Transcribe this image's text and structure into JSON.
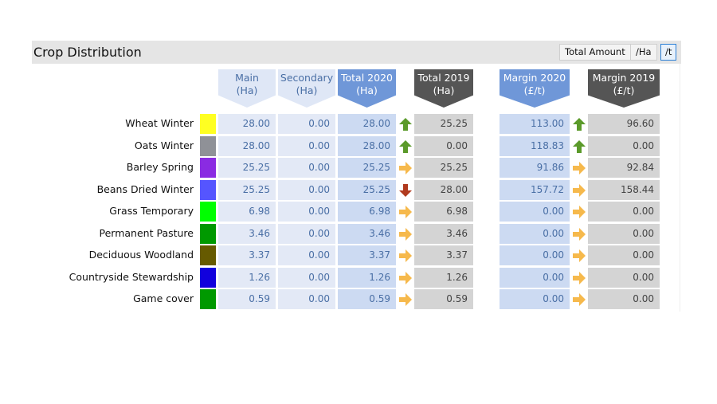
{
  "panel": {
    "title": "Crop Distribution",
    "buttons": [
      {
        "label": "Total Amount",
        "active": false
      },
      {
        "label": "/Ha",
        "active": false
      },
      {
        "label": "/t",
        "active": true
      }
    ]
  },
  "columns": {
    "main": {
      "line1": "Main",
      "line2": "(Ha)"
    },
    "secondary": {
      "line1": "Secondary",
      "line2": "(Ha)"
    },
    "total2020": {
      "line1": "Total 2020",
      "line2": "(Ha)"
    },
    "total2019": {
      "line1": "Total 2019",
      "line2": "(Ha)"
    },
    "margin2020": {
      "line1": "Margin 2020",
      "line2": "(£/t)"
    },
    "margin2019": {
      "line1": "Margin 2019",
      "line2": "(£/t)"
    }
  },
  "trend_icons": {
    "up": {
      "name": "arrow-up-icon",
      "color": "#5b9a2a"
    },
    "down": {
      "name": "arrow-down-icon",
      "color": "#b03a1e"
    },
    "flat": {
      "name": "arrow-right-icon",
      "color": "#f6b94c"
    }
  },
  "rows": [
    {
      "crop": "Wheat Winter",
      "color": "#ffff22",
      "main": "28.00",
      "secondary": "0.00",
      "total2020": "28.00",
      "total_trend": "up",
      "total2019": "25.25",
      "margin2020": "113.00",
      "margin_trend": "up",
      "margin2019": "96.60"
    },
    {
      "crop": "Oats Winter",
      "color": "#8f9197",
      "main": "28.00",
      "secondary": "0.00",
      "total2020": "28.00",
      "total_trend": "up",
      "total2019": "0.00",
      "margin2020": "118.83",
      "margin_trend": "up",
      "margin2019": "0.00"
    },
    {
      "crop": "Barley Spring",
      "color": "#8a2be2",
      "main": "25.25",
      "secondary": "0.00",
      "total2020": "25.25",
      "total_trend": "flat",
      "total2019": "25.25",
      "margin2020": "91.86",
      "margin_trend": "flat",
      "margin2019": "92.84"
    },
    {
      "crop": "Beans Dried Winter",
      "color": "#5555ff",
      "main": "25.25",
      "secondary": "0.00",
      "total2020": "25.25",
      "total_trend": "down",
      "total2019": "28.00",
      "margin2020": "157.72",
      "margin_trend": "flat",
      "margin2019": "158.44"
    },
    {
      "crop": "Grass Temporary",
      "color": "#00ff00",
      "main": "6.98",
      "secondary": "0.00",
      "total2020": "6.98",
      "total_trend": "flat",
      "total2019": "6.98",
      "margin2020": "0.00",
      "margin_trend": "flat",
      "margin2019": "0.00"
    },
    {
      "crop": "Permanent Pasture",
      "color": "#009900",
      "main": "3.46",
      "secondary": "0.00",
      "total2020": "3.46",
      "total_trend": "flat",
      "total2019": "3.46",
      "margin2020": "0.00",
      "margin_trend": "flat",
      "margin2019": "0.00"
    },
    {
      "crop": "Deciduous Woodland",
      "color": "#665a00",
      "main": "3.37",
      "secondary": "0.00",
      "total2020": "3.37",
      "total_trend": "flat",
      "total2019": "3.37",
      "margin2020": "0.00",
      "margin_trend": "flat",
      "margin2019": "0.00"
    },
    {
      "crop": "Countryside Stewardship",
      "color": "#1100dd",
      "main": "1.26",
      "secondary": "0.00",
      "total2020": "1.26",
      "total_trend": "flat",
      "total2019": "1.26",
      "margin2020": "0.00",
      "margin_trend": "flat",
      "margin2019": "0.00"
    },
    {
      "crop": "Game cover",
      "color": "#009900",
      "main": "0.59",
      "secondary": "0.00",
      "total2020": "0.59",
      "total_trend": "flat",
      "total2019": "0.59",
      "margin2020": "0.00",
      "margin_trend": "flat",
      "margin2019": "0.00"
    }
  ]
}
